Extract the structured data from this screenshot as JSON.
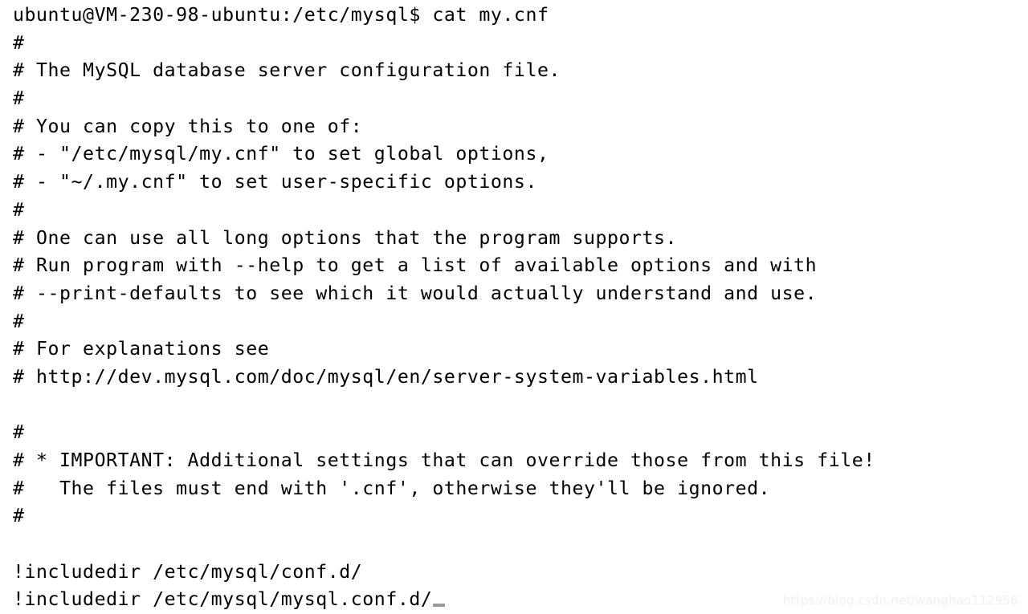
{
  "terminal": {
    "prompt": {
      "user": "ubuntu",
      "host": "VM-230-98-ubuntu",
      "cwd": "/etc/mysql",
      "symbol": "$",
      "command": "cat my.cnf",
      "full_line": "ubuntu@VM-230-98-ubuntu:/etc/mysql$ cat my.cnf"
    },
    "cursor": "_",
    "background_color": "#ffffff",
    "foreground_color": "#000000",
    "cursor_color": "#9a9a9a",
    "file_name": "my.cnf",
    "lines": [
      "ubuntu@VM-230-98-ubuntu:/etc/mysql$ cat my.cnf",
      "#",
      "# The MySQL database server configuration file.",
      "#",
      "# You can copy this to one of:",
      "# - \"/etc/mysql/my.cnf\" to set global options,",
      "# - \"~/.my.cnf\" to set user-specific options.",
      "#",
      "# One can use all long options that the program supports.",
      "# Run program with --help to get a list of available options and with",
      "# --print-defaults to see which it would actually understand and use.",
      "#",
      "# For explanations see",
      "# http://dev.mysql.com/doc/mysql/en/server-system-variables.html",
      "",
      "#",
      "# * IMPORTANT: Additional settings that can override those from this file!",
      "#   The files must end with '.cnf', otherwise they'll be ignored.",
      "#",
      "",
      "!includedir /etc/mysql/conf.d/",
      "!includedir /etc/mysql/mysql.conf.d/"
    ]
  },
  "watermark": {
    "text": "https://blog.csdn.net/wanghao112956"
  }
}
